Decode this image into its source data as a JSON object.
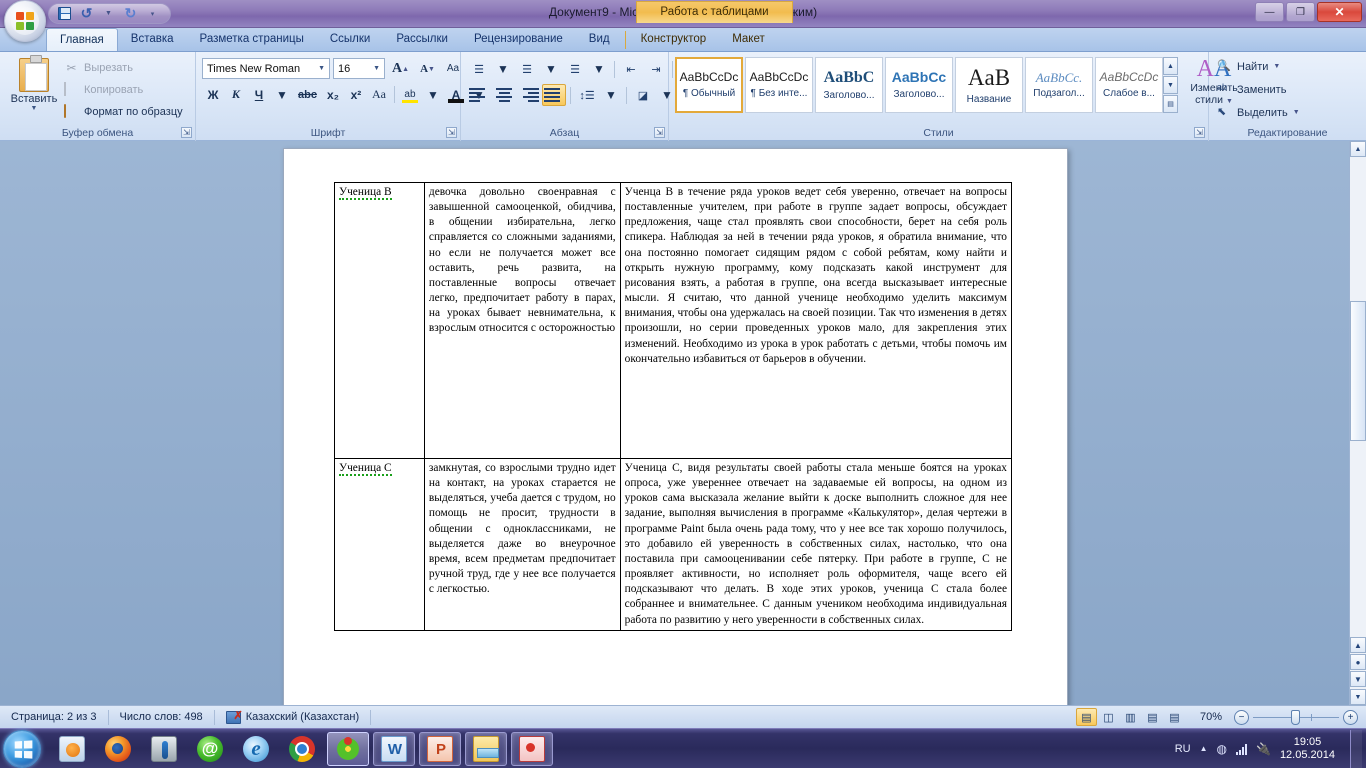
{
  "window": {
    "title": "Документ9 - Microsoft Word (безопасный режим)",
    "contextual_tab_title": "Работа с таблицами",
    "controls": {
      "minimize": "—",
      "restore": "❐",
      "close": "✕"
    }
  },
  "quick_access": {
    "save": "save-icon",
    "undo": "undo-icon",
    "redo": "redo-icon",
    "customize": "customize-icon"
  },
  "tabs": [
    {
      "label": "Главная",
      "active": true
    },
    {
      "label": "Вставка",
      "active": false
    },
    {
      "label": "Разметка страницы",
      "active": false
    },
    {
      "label": "Ссылки",
      "active": false
    },
    {
      "label": "Рассылки",
      "active": false
    },
    {
      "label": "Рецензирование",
      "active": false
    },
    {
      "label": "Вид",
      "active": false
    }
  ],
  "contextual_tabs": [
    {
      "label": "Конструктор"
    },
    {
      "label": "Макет"
    }
  ],
  "ribbon": {
    "clipboard": {
      "group_label": "Буфер обмена",
      "paste_label": "Вставить",
      "cut_label": "Вырезать",
      "copy_label": "Копировать",
      "format_painter_label": "Формат по образцу"
    },
    "font": {
      "group_label": "Шрифт",
      "font_name": "Times New Roman",
      "font_size": "16",
      "grow_font": "A",
      "shrink_font": "A",
      "clear_formatting": "Aa",
      "bold": "Ж",
      "italic": "К",
      "underline": "Ч",
      "strikethrough": "abc",
      "subscript": "x₂",
      "superscript": "x²",
      "change_case": "Aa",
      "highlight": "ab",
      "font_color": "A"
    },
    "paragraph": {
      "group_label": "Абзац",
      "bullets": "bullets-icon",
      "numbering": "numbering-icon",
      "multilevel": "multilevel-list-icon",
      "decrease_indent": "decrease-indent-icon",
      "increase_indent": "increase-indent-icon",
      "sort": "sort-icon",
      "show_marks": "¶",
      "align_left": "align-left-icon",
      "align_center": "align-center-icon",
      "align_right": "align-right-icon",
      "align_justify": "align-justify-icon",
      "line_spacing": "line-spacing-icon",
      "shading": "shading-icon",
      "borders": "borders-icon"
    },
    "styles": {
      "group_label": "Стили",
      "items": [
        {
          "preview": "AaBbCcDc",
          "name": "¶ Обычный",
          "selected": true
        },
        {
          "preview": "AaBbCcDc",
          "name": "¶ Без инте...",
          "selected": false
        },
        {
          "preview": "AaBbC",
          "name": "Заголово...",
          "selected": false
        },
        {
          "preview": "AaBbCc",
          "name": "Заголово...",
          "selected": false
        },
        {
          "preview": "АaВ",
          "name": "Название",
          "selected": false
        },
        {
          "preview": "AaBbCc.",
          "name": "Подзагол...",
          "selected": false
        },
        {
          "preview": "AaBbCcDc",
          "name": "Слабое в...",
          "selected": false
        }
      ],
      "change_styles_line1": "Изменить",
      "change_styles_line2": "стили"
    },
    "editing": {
      "group_label": "Редактирование",
      "find_label": "Найти",
      "replace_label": "Заменить",
      "select_label": "Выделить"
    }
  },
  "document": {
    "table": {
      "rows": [
        {
          "name": "Ученица В",
          "description": "девочка довольно своенравная с завышенной самооценкой, обидчива, в общении избирательна, легко справляется со сложными заданиями, но если не получается может все оставить, речь развита, на поставленные вопросы отвечает легко, предпочитает работу в парах, на уроках бывает невнимательна, к взрослым относится с осторожностью",
          "note": "    Ученца В в течение ряда уроков ведет себя уверенно, отвечает на вопросы поставленные учителем, при работе в группе задает вопросы, обсуждает предложения, чаще стал проявлять свои способности, берет на себя роль спикера. Наблюдая за ней в течении ряда уроков, я обратила внимание, что она постоянно помогает сидящим рядом с собой ребятам, кому найти и открыть нужную программу, кому подсказать какой инструмент для рисования взять, а работая в группе, она всегда высказывает интересные мысли.  Я считаю, что данной ученице необходимо уделить максимум внимания, чтобы она удержалась на своей позиции. Так что изменения в детях произошли, но серии проведенных уроков мало, для закрепления этих изменений. Необходимо из урока в урок работать с детьми, чтобы помочь им окончательно избавиться от барьеров в обучении."
        },
        {
          "name": "Ученица С",
          "description": "замкнутая, со взрослыми трудно идет на контакт, на уроках старается не выделяться, учеба дается с трудом, но помощь не просит, трудности в общении с одноклассниками, не выделяется даже во внеурочное время, всем предметам предпочитает ручной труд, где у нее все получается с легкостью.",
          "note": "Ученица С, видя результаты своей работы стала меньше боятся на уроках опроса, уже увереннее отвечает на задаваемые ей вопросы, на одном из уроков сама высказала желание выйти к доске выполнить сложное для нее задание, выполняя вычисления в программе «Калькулятор», делая чертежи в программе Paint была очень рада тому, что у нее все так хорошо получилось, это добавило ей уверенность в собственных силах, настолько, что она поставила при самооценивании себе пятерку.  При работе в группе, С не проявляет активности, но исполняет роль оформителя, чаще всего ей подсказывают что делать. В ходе этих уроков, ученица С стала более собраннее и внимательнее. С данным учеником необходима индивидуальная работа по развитию у него уверенности в собственных силах."
        }
      ]
    }
  },
  "status_bar": {
    "page": "Страница: 2 из 3",
    "word_count": "Число слов: 498",
    "language": "Казахский (Казахстан)",
    "proofing_icon": "proofing-errors-icon",
    "views": [
      {
        "name": "print-layout-view",
        "glyph": "▤",
        "selected": true
      },
      {
        "name": "full-screen-reading-view",
        "glyph": "◫",
        "selected": false
      },
      {
        "name": "web-layout-view",
        "glyph": "▥",
        "selected": false
      },
      {
        "name": "outline-view",
        "glyph": "▤",
        "selected": false
      },
      {
        "name": "draft-view",
        "glyph": "▤",
        "selected": false
      }
    ],
    "zoom": "70%",
    "zoom_out": "−",
    "zoom_in": "+"
  },
  "taskbar": {
    "start": "start-orb-icon",
    "items": [
      {
        "name": "windows-media-player",
        "icon": "wmp-icon",
        "state": "pinned"
      },
      {
        "name": "firefox",
        "icon": "firefox-icon",
        "state": "pinned"
      },
      {
        "name": "utility-app",
        "icon": "utility-icon",
        "state": "pinned"
      },
      {
        "name": "mail-agent",
        "icon": "mail-icon",
        "state": "pinned"
      },
      {
        "name": "internet-explorer",
        "icon": "ie-icon",
        "state": "pinned"
      },
      {
        "name": "google-chrome",
        "icon": "chrome-icon",
        "state": "pinned"
      },
      {
        "name": "icq",
        "icon": "icq-icon",
        "state": "active"
      },
      {
        "name": "microsoft-word",
        "icon": "word-icon",
        "state": "open"
      },
      {
        "name": "microsoft-powerpoint",
        "icon": "powerpoint-icon",
        "state": "open"
      },
      {
        "name": "file-explorer",
        "icon": "folder-icon",
        "state": "open"
      },
      {
        "name": "paint",
        "icon": "paint-icon",
        "state": "open"
      }
    ],
    "tray": {
      "language": "RU",
      "show_hidden": "▲",
      "volume": "volume-icon",
      "network": "network-icon",
      "power": "power-icon",
      "time": "19:05",
      "date": "12.05.2014"
    }
  }
}
